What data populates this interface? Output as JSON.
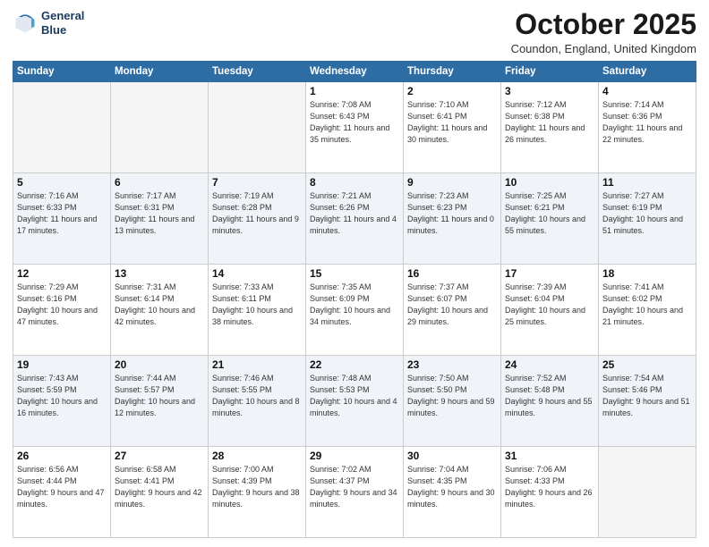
{
  "header": {
    "logo_line1": "General",
    "logo_line2": "Blue",
    "month": "October 2025",
    "location": "Coundon, England, United Kingdom"
  },
  "weekdays": [
    "Sunday",
    "Monday",
    "Tuesday",
    "Wednesday",
    "Thursday",
    "Friday",
    "Saturday"
  ],
  "weeks": [
    [
      {
        "day": "",
        "sunrise": "",
        "sunset": "",
        "daylight": ""
      },
      {
        "day": "",
        "sunrise": "",
        "sunset": "",
        "daylight": ""
      },
      {
        "day": "",
        "sunrise": "",
        "sunset": "",
        "daylight": ""
      },
      {
        "day": "1",
        "sunrise": "Sunrise: 7:08 AM",
        "sunset": "Sunset: 6:43 PM",
        "daylight": "Daylight: 11 hours and 35 minutes."
      },
      {
        "day": "2",
        "sunrise": "Sunrise: 7:10 AM",
        "sunset": "Sunset: 6:41 PM",
        "daylight": "Daylight: 11 hours and 30 minutes."
      },
      {
        "day": "3",
        "sunrise": "Sunrise: 7:12 AM",
        "sunset": "Sunset: 6:38 PM",
        "daylight": "Daylight: 11 hours and 26 minutes."
      },
      {
        "day": "4",
        "sunrise": "Sunrise: 7:14 AM",
        "sunset": "Sunset: 6:36 PM",
        "daylight": "Daylight: 11 hours and 22 minutes."
      }
    ],
    [
      {
        "day": "5",
        "sunrise": "Sunrise: 7:16 AM",
        "sunset": "Sunset: 6:33 PM",
        "daylight": "Daylight: 11 hours and 17 minutes."
      },
      {
        "day": "6",
        "sunrise": "Sunrise: 7:17 AM",
        "sunset": "Sunset: 6:31 PM",
        "daylight": "Daylight: 11 hours and 13 minutes."
      },
      {
        "day": "7",
        "sunrise": "Sunrise: 7:19 AM",
        "sunset": "Sunset: 6:28 PM",
        "daylight": "Daylight: 11 hours and 9 minutes."
      },
      {
        "day": "8",
        "sunrise": "Sunrise: 7:21 AM",
        "sunset": "Sunset: 6:26 PM",
        "daylight": "Daylight: 11 hours and 4 minutes."
      },
      {
        "day": "9",
        "sunrise": "Sunrise: 7:23 AM",
        "sunset": "Sunset: 6:23 PM",
        "daylight": "Daylight: 11 hours and 0 minutes."
      },
      {
        "day": "10",
        "sunrise": "Sunrise: 7:25 AM",
        "sunset": "Sunset: 6:21 PM",
        "daylight": "Daylight: 10 hours and 55 minutes."
      },
      {
        "day": "11",
        "sunrise": "Sunrise: 7:27 AM",
        "sunset": "Sunset: 6:19 PM",
        "daylight": "Daylight: 10 hours and 51 minutes."
      }
    ],
    [
      {
        "day": "12",
        "sunrise": "Sunrise: 7:29 AM",
        "sunset": "Sunset: 6:16 PM",
        "daylight": "Daylight: 10 hours and 47 minutes."
      },
      {
        "day": "13",
        "sunrise": "Sunrise: 7:31 AM",
        "sunset": "Sunset: 6:14 PM",
        "daylight": "Daylight: 10 hours and 42 minutes."
      },
      {
        "day": "14",
        "sunrise": "Sunrise: 7:33 AM",
        "sunset": "Sunset: 6:11 PM",
        "daylight": "Daylight: 10 hours and 38 minutes."
      },
      {
        "day": "15",
        "sunrise": "Sunrise: 7:35 AM",
        "sunset": "Sunset: 6:09 PM",
        "daylight": "Daylight: 10 hours and 34 minutes."
      },
      {
        "day": "16",
        "sunrise": "Sunrise: 7:37 AM",
        "sunset": "Sunset: 6:07 PM",
        "daylight": "Daylight: 10 hours and 29 minutes."
      },
      {
        "day": "17",
        "sunrise": "Sunrise: 7:39 AM",
        "sunset": "Sunset: 6:04 PM",
        "daylight": "Daylight: 10 hours and 25 minutes."
      },
      {
        "day": "18",
        "sunrise": "Sunrise: 7:41 AM",
        "sunset": "Sunset: 6:02 PM",
        "daylight": "Daylight: 10 hours and 21 minutes."
      }
    ],
    [
      {
        "day": "19",
        "sunrise": "Sunrise: 7:43 AM",
        "sunset": "Sunset: 5:59 PM",
        "daylight": "Daylight: 10 hours and 16 minutes."
      },
      {
        "day": "20",
        "sunrise": "Sunrise: 7:44 AM",
        "sunset": "Sunset: 5:57 PM",
        "daylight": "Daylight: 10 hours and 12 minutes."
      },
      {
        "day": "21",
        "sunrise": "Sunrise: 7:46 AM",
        "sunset": "Sunset: 5:55 PM",
        "daylight": "Daylight: 10 hours and 8 minutes."
      },
      {
        "day": "22",
        "sunrise": "Sunrise: 7:48 AM",
        "sunset": "Sunset: 5:53 PM",
        "daylight": "Daylight: 10 hours and 4 minutes."
      },
      {
        "day": "23",
        "sunrise": "Sunrise: 7:50 AM",
        "sunset": "Sunset: 5:50 PM",
        "daylight": "Daylight: 9 hours and 59 minutes."
      },
      {
        "day": "24",
        "sunrise": "Sunrise: 7:52 AM",
        "sunset": "Sunset: 5:48 PM",
        "daylight": "Daylight: 9 hours and 55 minutes."
      },
      {
        "day": "25",
        "sunrise": "Sunrise: 7:54 AM",
        "sunset": "Sunset: 5:46 PM",
        "daylight": "Daylight: 9 hours and 51 minutes."
      }
    ],
    [
      {
        "day": "26",
        "sunrise": "Sunrise: 6:56 AM",
        "sunset": "Sunset: 4:44 PM",
        "daylight": "Daylight: 9 hours and 47 minutes."
      },
      {
        "day": "27",
        "sunrise": "Sunrise: 6:58 AM",
        "sunset": "Sunset: 4:41 PM",
        "daylight": "Daylight: 9 hours and 42 minutes."
      },
      {
        "day": "28",
        "sunrise": "Sunrise: 7:00 AM",
        "sunset": "Sunset: 4:39 PM",
        "daylight": "Daylight: 9 hours and 38 minutes."
      },
      {
        "day": "29",
        "sunrise": "Sunrise: 7:02 AM",
        "sunset": "Sunset: 4:37 PM",
        "daylight": "Daylight: 9 hours and 34 minutes."
      },
      {
        "day": "30",
        "sunrise": "Sunrise: 7:04 AM",
        "sunset": "Sunset: 4:35 PM",
        "daylight": "Daylight: 9 hours and 30 minutes."
      },
      {
        "day": "31",
        "sunrise": "Sunrise: 7:06 AM",
        "sunset": "Sunset: 4:33 PM",
        "daylight": "Daylight: 9 hours and 26 minutes."
      },
      {
        "day": "",
        "sunrise": "",
        "sunset": "",
        "daylight": ""
      }
    ]
  ]
}
